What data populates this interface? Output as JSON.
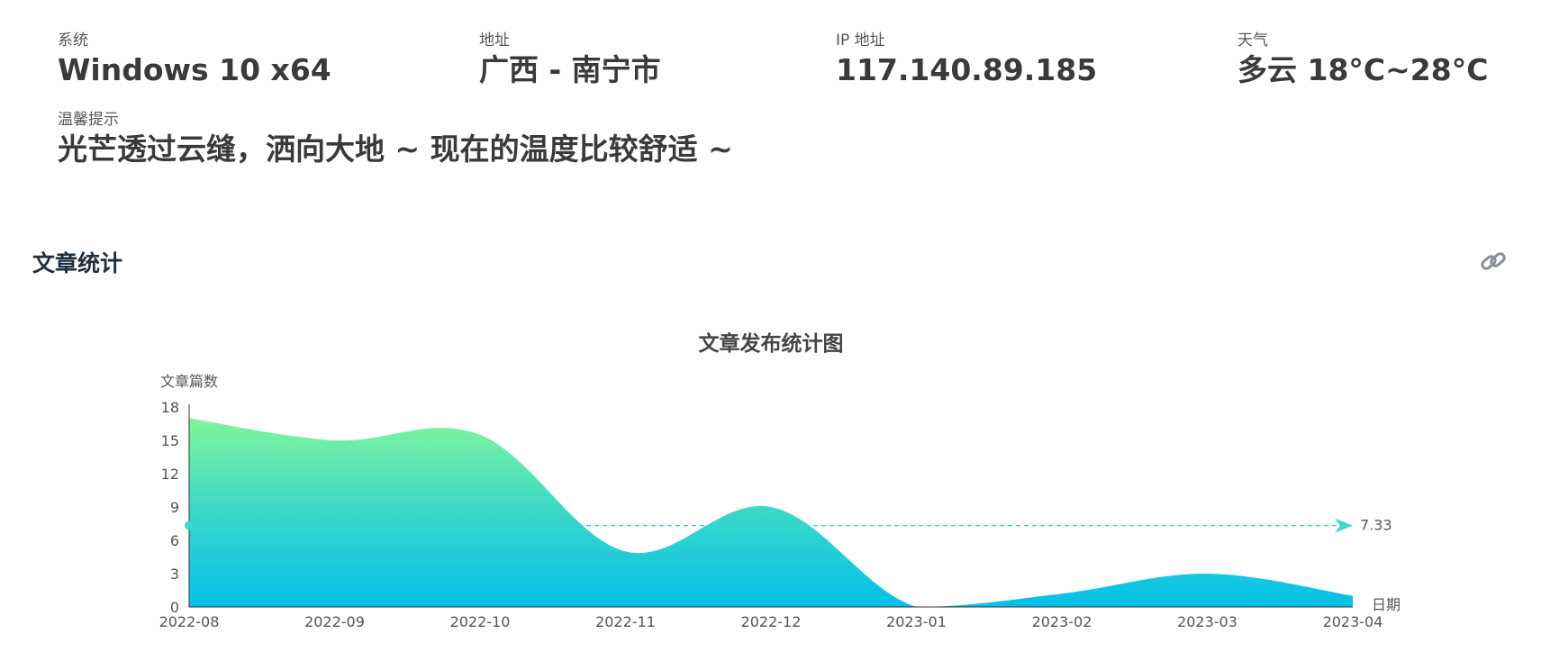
{
  "info": {
    "system": {
      "label": "系统",
      "value": "Windows 10 x64"
    },
    "address": {
      "label": "地址",
      "value": "广西 - 南宁市"
    },
    "ip": {
      "label": "IP 地址",
      "value": "117.140.89.185"
    },
    "weather": {
      "label": "天气",
      "value": "多云 18°C~28°C"
    },
    "tip": {
      "label": "温馨提示",
      "value": "光芒透过云缝，洒向大地 ~ 现在的温度比较舒适 ~"
    }
  },
  "section": {
    "title": "文章统计",
    "link_icon": "link-icon"
  },
  "chart_data": {
    "type": "area",
    "title": "文章发布统计图",
    "ylabel": "文章篇数",
    "xlabel": "日期",
    "categories": [
      "2022-08",
      "2022-09",
      "2022-10",
      "2022-11",
      "2022-12",
      "2023-01",
      "2023-02",
      "2023-03",
      "2023-04"
    ],
    "values": [
      17,
      15,
      15.5,
      5,
      9,
      0,
      1.2,
      3,
      1
    ],
    "ylim": [
      0,
      18
    ],
    "yticks": [
      0,
      3,
      6,
      9,
      12,
      15,
      18
    ],
    "average": {
      "value": 7.33,
      "label": "7.33"
    },
    "colors": {
      "gradient_top": "#80f59c",
      "gradient_mid": "#3ad8c8",
      "gradient_bottom": "#05c0ea",
      "average_line": "#3ad8c8",
      "axis": "#333333",
      "text": "#555555"
    },
    "grid": false
  }
}
